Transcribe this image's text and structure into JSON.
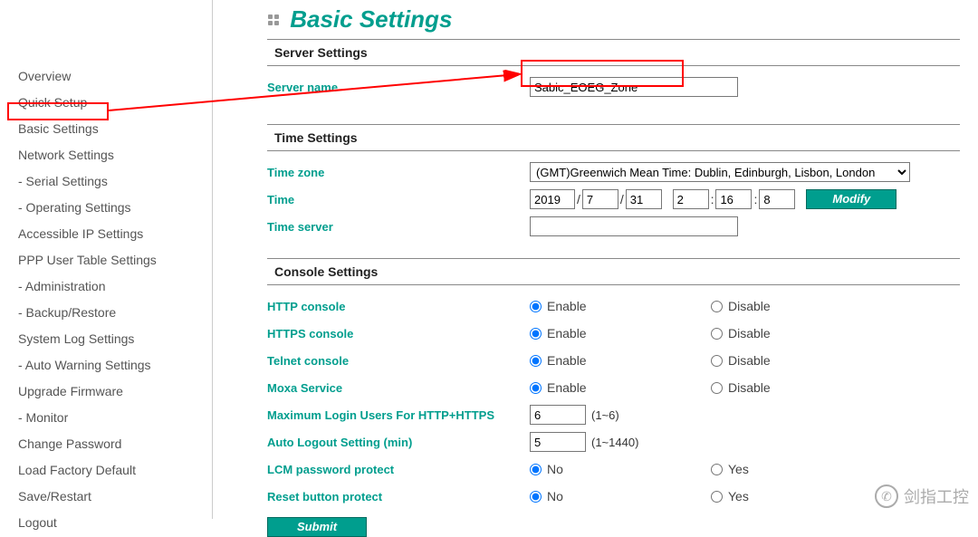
{
  "sidebar": {
    "items": [
      {
        "label": "Overview"
      },
      {
        "label": "Quick Setup"
      },
      {
        "label": "Basic Settings"
      },
      {
        "label": "Network Settings"
      },
      {
        "label": "- Serial Settings"
      },
      {
        "label": "- Operating Settings"
      },
      {
        "label": "Accessible IP Settings"
      },
      {
        "label": "PPP User Table Settings"
      },
      {
        "label": "- Administration"
      },
      {
        "label": "- Backup/Restore"
      },
      {
        "label": "System Log Settings"
      },
      {
        "label": "- Auto Warning Settings"
      },
      {
        "label": "Upgrade Firmware"
      },
      {
        "label": "- Monitor"
      },
      {
        "label": "Change Password"
      },
      {
        "label": "Load Factory Default"
      },
      {
        "label": "Save/Restart"
      },
      {
        "label": "Logout"
      }
    ]
  },
  "page": {
    "title": "Basic Settings"
  },
  "server_settings": {
    "section_title": "Server Settings",
    "server_name_label": "Server name",
    "server_name_value": "Sabic_EOEG_Zone"
  },
  "time_settings": {
    "section_title": "Time Settings",
    "timezone_label": "Time zone",
    "timezone_value": "(GMT)Greenwich Mean Time: Dublin, Edinburgh, Lisbon, London",
    "time_label": "Time",
    "year": "2019",
    "month": "7",
    "day": "31",
    "hour": "2",
    "minute": "16",
    "second": "8",
    "modify_label": "Modify",
    "time_server_label": "Time server",
    "time_server_value": ""
  },
  "console_settings": {
    "section_title": "Console Settings",
    "http_console_label": "HTTP console",
    "https_console_label": "HTTPS console",
    "telnet_console_label": "Telnet console",
    "moxa_service_label": "Moxa Service",
    "enable": "Enable",
    "disable": "Disable",
    "max_login_label": "Maximum Login Users For HTTP+HTTPS",
    "max_login_value": "6",
    "max_login_hint": "(1~6)",
    "auto_logout_label": "Auto Logout Setting (min)",
    "auto_logout_value": "5",
    "auto_logout_hint": "(1~1440)",
    "lcm_protect_label": "LCM password protect",
    "reset_protect_label": "Reset button protect",
    "no": "No",
    "yes": "Yes",
    "submit_label": "Submit"
  },
  "watermark": {
    "text": "剑指工控"
  }
}
